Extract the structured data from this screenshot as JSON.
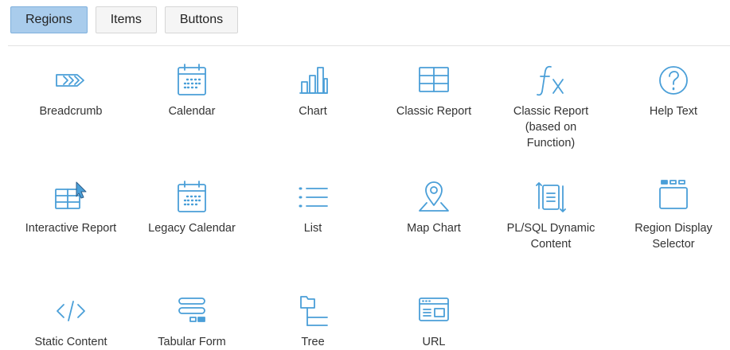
{
  "colors": {
    "accent": "#4a9fd8",
    "active_tab_bg": "#a9ccec",
    "tab_bg": "#f5f5f5"
  },
  "tabs": [
    {
      "label": "Regions",
      "active": true
    },
    {
      "label": "Items",
      "active": false
    },
    {
      "label": "Buttons",
      "active": false
    }
  ],
  "regions": [
    {
      "label": "Breadcrumb",
      "icon": "breadcrumb-icon"
    },
    {
      "label": "Calendar",
      "icon": "calendar-icon"
    },
    {
      "label": "Chart",
      "icon": "bar-chart-icon"
    },
    {
      "label": "Classic Report",
      "icon": "table-icon"
    },
    {
      "label": "Classic Report (based on Function)",
      "icon": "function-icon"
    },
    {
      "label": "Help Text",
      "icon": "help-circle-icon"
    },
    {
      "label": "Interactive Report",
      "icon": "interactive-table-icon"
    },
    {
      "label": "Legacy Calendar",
      "icon": "calendar-icon"
    },
    {
      "label": "List",
      "icon": "list-icon"
    },
    {
      "label": "Map Chart",
      "icon": "map-pin-icon"
    },
    {
      "label": "PL/SQL Dynamic Content",
      "icon": "dynamic-document-icon"
    },
    {
      "label": "Region Display Selector",
      "icon": "window-selector-icon"
    },
    {
      "label": "Static Content",
      "icon": "code-icon"
    },
    {
      "label": "Tabular Form",
      "icon": "tabular-form-icon"
    },
    {
      "label": "Tree",
      "icon": "tree-icon"
    },
    {
      "label": "URL",
      "icon": "url-window-icon"
    }
  ]
}
